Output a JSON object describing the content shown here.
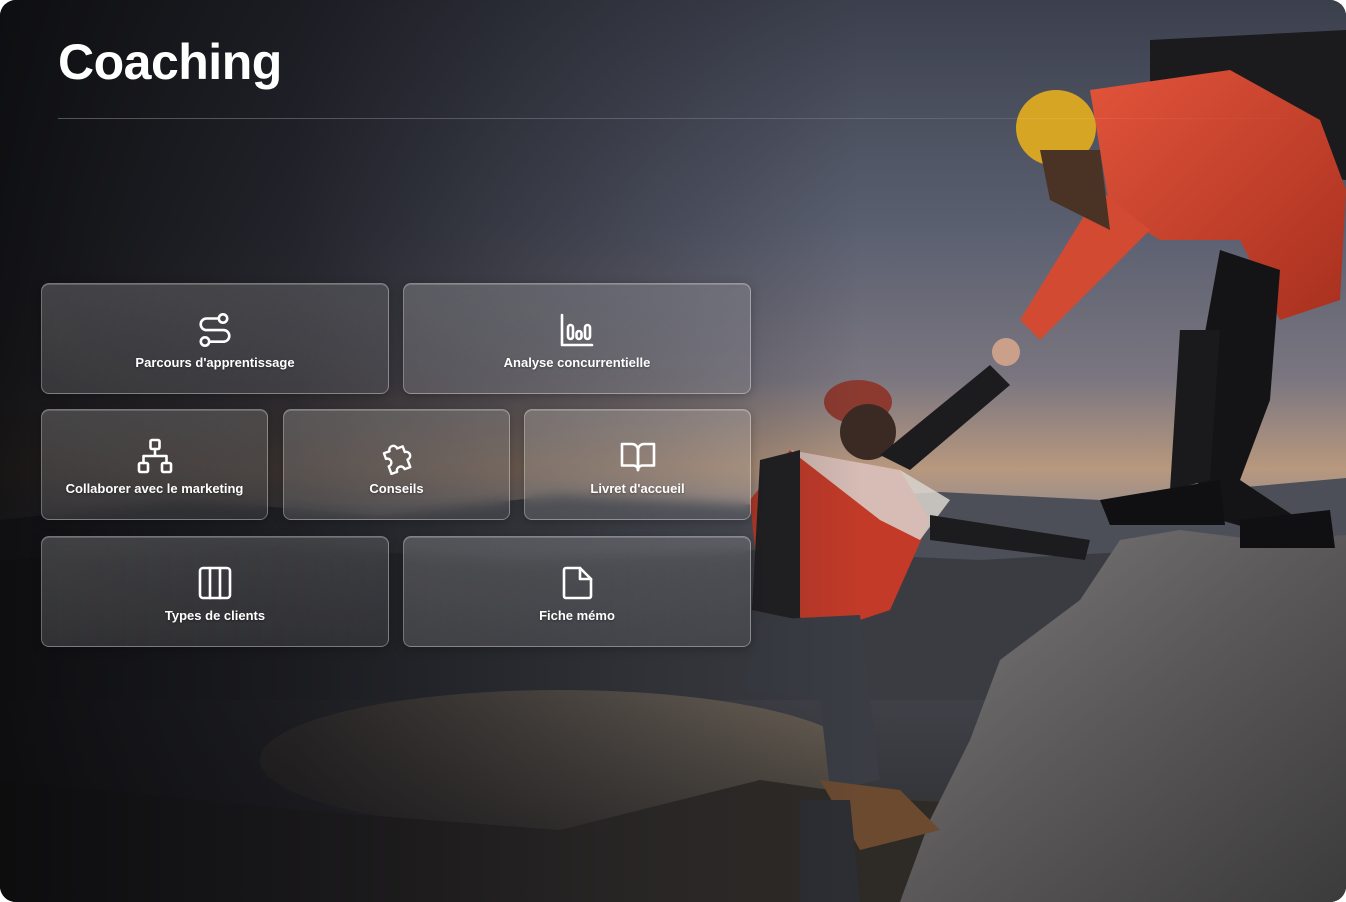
{
  "page": {
    "title": "Coaching"
  },
  "tiles": [
    {
      "label": "Parcours d'apprentissage",
      "icon": "route-icon"
    },
    {
      "label": "Analyse concurrentielle",
      "icon": "bar-chart-icon"
    },
    {
      "label": "Collaborer avec le marketing",
      "icon": "hierarchy-icon"
    },
    {
      "label": "Conseils",
      "icon": "puzzle-icon"
    },
    {
      "label": "Livret d'accueil",
      "icon": "open-book-icon"
    },
    {
      "label": "Types de clients",
      "icon": "columns-icon"
    },
    {
      "label": "Fiche mémo",
      "icon": "document-icon"
    }
  ],
  "colors": {
    "text": "#ffffff",
    "jacket": "#d8432c",
    "hat": "#d4a21e",
    "sky_top": "#3e4453",
    "sunset": "#c9a27a"
  }
}
